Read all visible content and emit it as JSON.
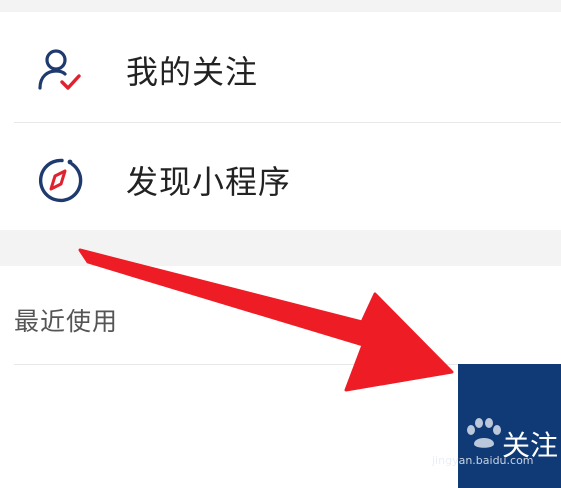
{
  "menu": {
    "items": [
      {
        "label": "我的关注",
        "icon": "person-check-icon"
      },
      {
        "label": "发现小程序",
        "icon": "compass-icon"
      }
    ]
  },
  "recent": {
    "title": "最近使用",
    "follow_tile_label": "关注"
  },
  "watermark": {
    "text": "jingyan.baidu.com"
  },
  "colors": {
    "accent_red": "#e0212e",
    "icon_navy": "#1f3a6e",
    "tile_navy": "#0f3a76"
  }
}
